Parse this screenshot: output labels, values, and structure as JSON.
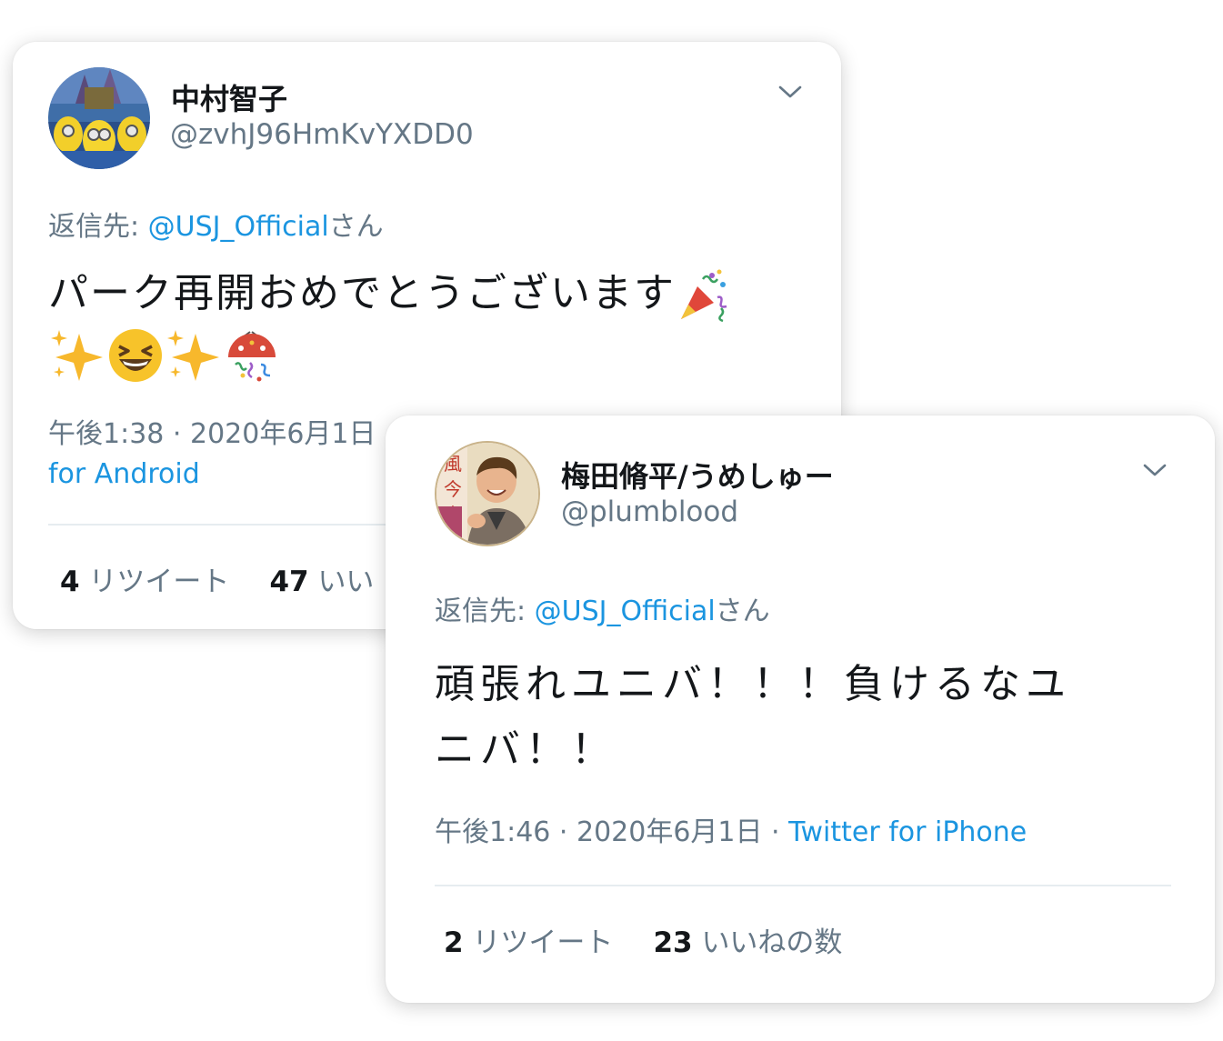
{
  "tweets": [
    {
      "display_name": "中村智子",
      "handle": "@zvhJ96HmKvYXDD0",
      "reply_prefix": "返信先: ",
      "reply_mention": "@USJ_Official",
      "reply_suffix": "さん",
      "text_line1": "パーク再開おめでとうございます",
      "emojis_line1": [
        "party-popper-emoji"
      ],
      "emojis_line2": [
        "sparkles-emoji",
        "laughing-face-emoji",
        "sparkles-emoji",
        "confetti-ball-emoji"
      ],
      "timestamp": "午後1:38 · 2020年6月1日",
      "source": "for Android",
      "retweet_count": "4",
      "retweet_label": "リツイート",
      "like_count": "47",
      "like_label": "いい"
    },
    {
      "display_name": "梅田脩平/うめしゅー",
      "handle": "@plumblood",
      "reply_prefix": "返信先: ",
      "reply_mention": "@USJ_Official",
      "reply_suffix": "さん",
      "text_line1": "頑張れユニバ！！！負けるなユ",
      "text_line2": "ニバ！！",
      "timestamp": "午後1:46 · 2020年6月1日",
      "separator": " · ",
      "source": "Twitter for iPhone",
      "retweet_count": "2",
      "retweet_label": "リツイート",
      "like_count": "23",
      "like_label": "いいねの数"
    }
  ],
  "colors": {
    "text": "#14171a",
    "secondary": "#657786",
    "link": "#1b95e0",
    "divider": "#e6ecf0"
  }
}
